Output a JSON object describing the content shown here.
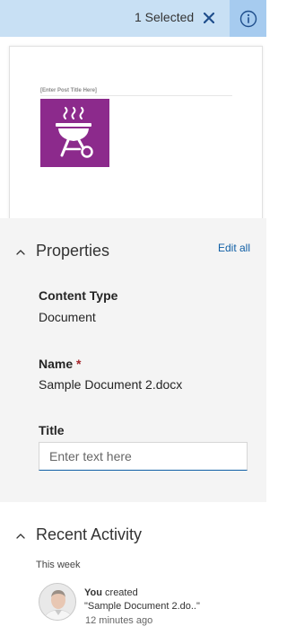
{
  "header": {
    "selected_label": "1 Selected",
    "close_icon": "close-icon",
    "info_icon": "info-icon"
  },
  "preview": {
    "post_title_placeholder": "[Enter Post Title Here]",
    "logo_icon": "grill-icon",
    "logo_color": "#8c2a8c"
  },
  "properties": {
    "section_title": "Properties",
    "edit_all_label": "Edit all",
    "content_type_label": "Content Type",
    "content_type_value": "Document",
    "name_label": "Name",
    "name_required_marker": "*",
    "name_value": "Sample Document 2.docx",
    "title_label": "Title",
    "title_placeholder": "Enter text here"
  },
  "recent_activity": {
    "section_title": "Recent Activity",
    "period_label": "This week",
    "items": [
      {
        "actor": "You",
        "action": "created",
        "document": "\"Sample Document 2.do..\"",
        "time": "12 minutes ago"
      }
    ]
  },
  "colors": {
    "header_bg": "#c8e0f4",
    "info_button_bg": "#a6cbef",
    "accent": "#0f5ea5",
    "required": "#a4262c",
    "panel_bg": "#f4f4f4"
  }
}
